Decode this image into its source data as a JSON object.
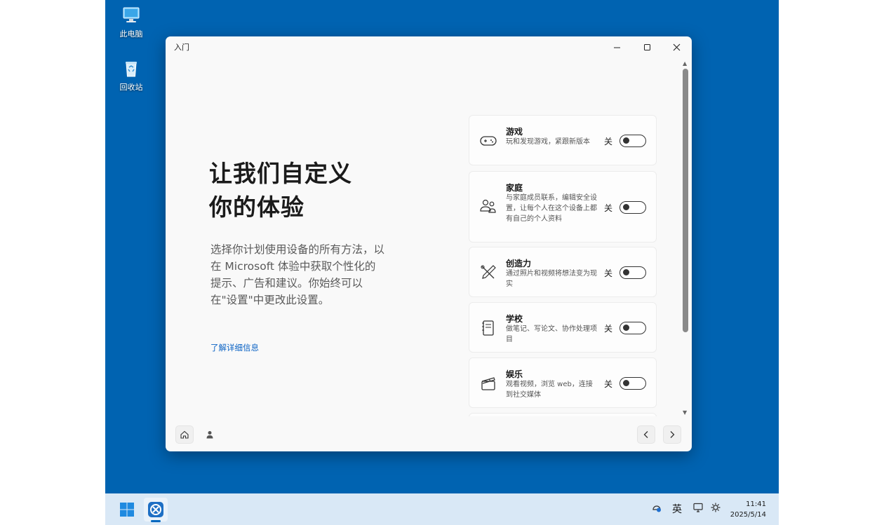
{
  "desktop": {
    "icons": [
      {
        "label": "此电脑",
        "icon": "computer-icon"
      },
      {
        "label": "回收站",
        "icon": "recycle-bin-icon"
      }
    ]
  },
  "window": {
    "title": "入门",
    "controls": {
      "minimize": "minimize-icon",
      "maximize": "maximize-icon",
      "close": "close-icon"
    }
  },
  "hero": {
    "heading_line1": "让我们自定义",
    "heading_line2": "你的体验",
    "description": "选择你计划使用设备的所有方法，以在 Microsoft 体验中获取个性化的提示、广告和建议。你始终可以在\"设置\"中更改此设置。",
    "learn_more": "了解详细信息"
  },
  "options": [
    {
      "title": "游戏",
      "desc": "玩和发现游戏，紧跟新版本",
      "state": "关",
      "icon": "gamepad-icon",
      "enabled": false
    },
    {
      "title": "家庭",
      "desc": "与家庭成员联系，编辑安全设置，让每个人在这个设备上都有自己的个人资料",
      "state": "关",
      "icon": "family-icon",
      "enabled": false
    },
    {
      "title": "创造力",
      "desc": "通过照片和视频将想法变为现实",
      "state": "关",
      "icon": "brush-pen-icon",
      "enabled": false
    },
    {
      "title": "学校",
      "desc": "做笔记、写论文、协作处理项目",
      "state": "关",
      "icon": "notebook-icon",
      "enabled": false
    },
    {
      "title": "娱乐",
      "desc": "观看视频，浏览 web，连接到社交媒体",
      "state": "关",
      "icon": "clapperboard-icon",
      "enabled": false
    }
  ],
  "footer": {
    "home_icon": "home-icon",
    "account_icon": "person-icon",
    "back_icon": "chevron-left-icon",
    "next_icon": "chevron-right-icon"
  },
  "taskbar": {
    "start_icon": "windows-start-icon",
    "app_icon": "setup-app-icon",
    "tray": {
      "network_icon": "network-icon",
      "ime": "英",
      "device_icon": "display-icon",
      "settings_icon": "gear-icon"
    },
    "time": "11:41",
    "date": "2025/5/14"
  }
}
